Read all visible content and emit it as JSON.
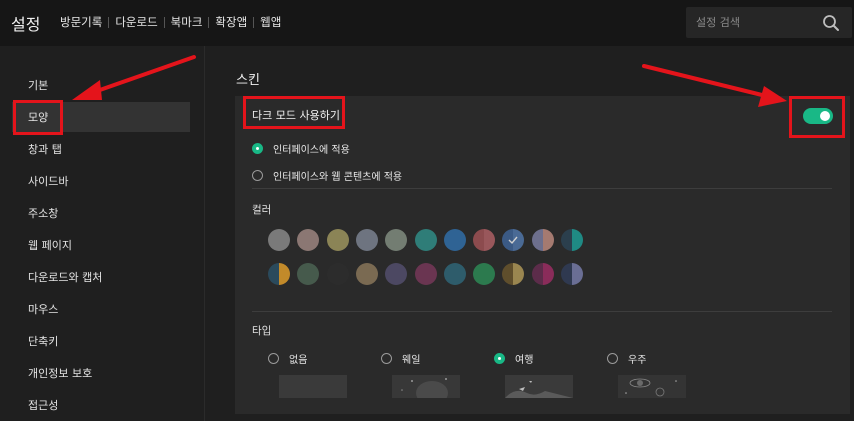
{
  "header": {
    "title": "설정",
    "nav": [
      "방문기록",
      "다운로드",
      "북마크",
      "확장앱",
      "웹앱"
    ],
    "search_placeholder": "설정 검색",
    "search_icon": "search-icon"
  },
  "sidebar": {
    "items": [
      {
        "label": "기본",
        "active": false
      },
      {
        "label": "모양",
        "active": true
      },
      {
        "label": "창과 탭",
        "active": false
      },
      {
        "label": "사이드바",
        "active": false
      },
      {
        "label": "주소창",
        "active": false
      },
      {
        "label": "웹 페이지",
        "active": false
      },
      {
        "label": "다운로드와 캡처",
        "active": false
      },
      {
        "label": "마우스",
        "active": false
      },
      {
        "label": "단축키",
        "active": false
      },
      {
        "label": "개인정보 보호",
        "active": false
      },
      {
        "label": "접근성",
        "active": false
      }
    ]
  },
  "skin": {
    "title": "스킨",
    "dark_mode_label": "다크 모드 사용하기",
    "dark_mode_on": true,
    "apply_options": [
      {
        "label": "인터페이스에 적용",
        "selected": true
      },
      {
        "label": "인터페이스와 웹 콘텐츠에 적용",
        "selected": false
      }
    ],
    "color_label": "컬러",
    "colors": [
      [
        "#7a7a7a",
        "#7a7a7a"
      ],
      [
        "#8b7773",
        "#8b7773"
      ],
      [
        "#8b8456",
        "#8b8456"
      ],
      [
        "#6e7480",
        "#6e7480"
      ],
      [
        "#737d72",
        "#737d72"
      ],
      [
        "#2f7d78",
        "#2f7d78"
      ],
      [
        "#2f6394",
        "#2f6394"
      ],
      [
        "#8c4b4e",
        "#99575b"
      ],
      [
        "#3b5a85",
        "#4a6a95"
      ],
      [
        "#6d6f8d",
        "#a57a70"
      ],
      [
        "#2b3f4d",
        "#1f8a84"
      ],
      [
        "#2a4a5c",
        "#c28a2a"
      ],
      [
        "#465a4c",
        "#465a4c"
      ],
      [
        "#2c2c2c",
        "#2c2c2c"
      ],
      [
        "#7a6a52",
        "#7a6a52"
      ],
      [
        "#4c4862",
        "#4c4862"
      ],
      [
        "#6a3551",
        "#6a3551"
      ],
      [
        "#2e5c6b",
        "#2e5c6b"
      ],
      [
        "#2c7a4e",
        "#2c7a4e"
      ],
      [
        "#5f4e2c",
        "#9a8650"
      ],
      [
        "#5c2c4a",
        "#8a2c5a"
      ],
      [
        "#2f3950",
        "#6a6e94"
      ]
    ],
    "selected_color_index": 8,
    "type_label": "타입",
    "types": [
      {
        "label": "없음",
        "selected": false
      },
      {
        "label": "웨일",
        "selected": false
      },
      {
        "label": "여행",
        "selected": true
      },
      {
        "label": "우주",
        "selected": false
      }
    ]
  },
  "colors": {
    "accent": "#19b886",
    "annotation": "#e4141b"
  }
}
